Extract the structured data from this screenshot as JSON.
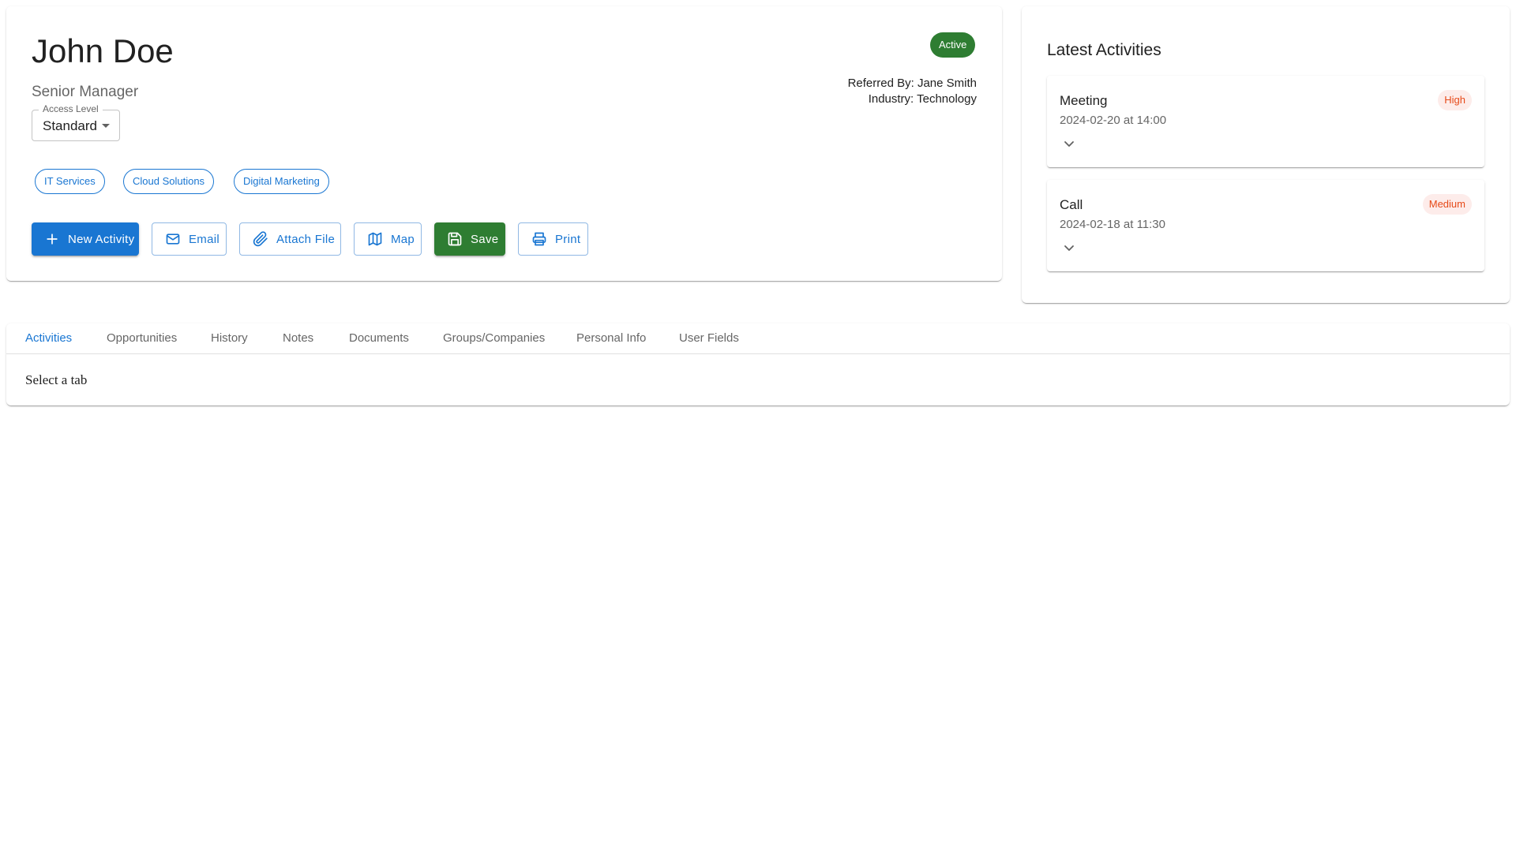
{
  "contact": {
    "name": "John Doe",
    "title": "Senior Manager",
    "access_level": {
      "label": "Access Level",
      "value": "Standard"
    },
    "status": "Active",
    "referred_by": "Referred By: Jane Smith",
    "industry": "Industry: Technology",
    "tags": [
      "IT Services",
      "Cloud Solutions",
      "Digital Marketing"
    ]
  },
  "actions": {
    "new_activity": "New Activity",
    "email": "Email",
    "attach_file": "Attach File",
    "map": "Map",
    "save": "Save",
    "print": "Print"
  },
  "latest_activities": {
    "title": "Latest Activities",
    "items": [
      {
        "type": "Meeting",
        "time": "2024-02-20 at 14:00",
        "priority": "High"
      },
      {
        "type": "Call",
        "time": "2024-02-18 at 11:30",
        "priority": "Medium"
      }
    ]
  },
  "tabs": {
    "items": [
      "Activities",
      "Opportunities",
      "History",
      "Notes",
      "Documents",
      "Groups/Companies",
      "Personal Info",
      "User Fields"
    ],
    "active": "Activities",
    "content": "Select a tab"
  },
  "icons": {
    "new_activity": "plus-icon",
    "email": "mail-icon",
    "attach_file": "paperclip-icon",
    "map": "map-icon",
    "save": "floppy-disk-icon",
    "print": "printer-icon",
    "expand": "chevron-down-icon"
  },
  "colors": {
    "primary": "#1976d2",
    "success": "#2e7d32",
    "priority_text": "#e64a19",
    "priority_bg": "#fdecea"
  }
}
